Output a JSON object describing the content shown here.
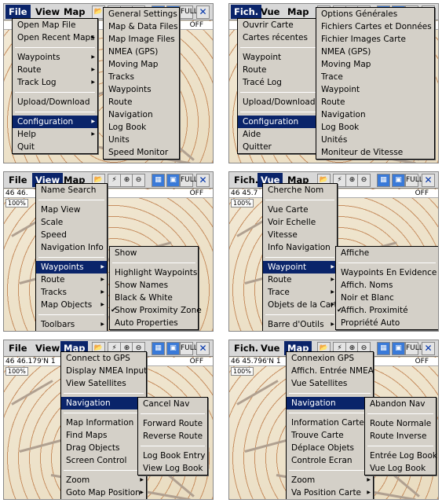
{
  "panels": [
    {
      "menus": [
        "File",
        "View",
        "Map"
      ],
      "coord": "",
      "off": "OFF",
      "zoom": "",
      "active": 0,
      "main": [
        {
          "t": "Open Map File"
        },
        {
          "t": "Open Recent Maps",
          "sub": 1
        },
        {
          "sep": 1
        },
        {
          "t": "Waypoints",
          "sub": 1
        },
        {
          "t": "Route",
          "sub": 1
        },
        {
          "t": "Track Log",
          "sub": 1
        },
        {
          "sep": 1
        },
        {
          "t": "Upload/Download"
        },
        {
          "sep": 1
        },
        {
          "t": "Configuration",
          "sub": 1,
          "sel": 1
        },
        {
          "t": "Help",
          "sub": 1
        },
        {
          "t": "Quit"
        }
      ],
      "submenu": [
        {
          "t": "General Settings"
        },
        {
          "t": "Map & Data Files"
        },
        {
          "t": "Map Image Files"
        },
        {
          "t": "NMEA (GPS)"
        },
        {
          "t": "Moving Map"
        },
        {
          "t": "Tracks"
        },
        {
          "t": "Waypoints"
        },
        {
          "t": "Route"
        },
        {
          "t": "Navigation"
        },
        {
          "t": "Log Book"
        },
        {
          "t": "Units"
        },
        {
          "t": "Speed Monitor"
        }
      ]
    },
    {
      "menus": [
        "Fich.",
        "Vue",
        "Map"
      ],
      "coord": "",
      "off": "OFF",
      "zoom": "",
      "active": 0,
      "main": [
        {
          "t": "Ouvrir Carte"
        },
        {
          "t": "Cartes récentes",
          "sub": 1
        },
        {
          "sep": 1
        },
        {
          "t": "Waypoint",
          "sub": 1
        },
        {
          "t": "Route",
          "sub": 1
        },
        {
          "t": "Tracé Log",
          "sub": 1
        },
        {
          "sep": 1
        },
        {
          "t": "Upload/Download"
        },
        {
          "sep": 1
        },
        {
          "t": "Configuration",
          "sub": 1,
          "sel": 1
        },
        {
          "t": "Aide",
          "sub": 1
        },
        {
          "t": "Quitter"
        }
      ],
      "submenu": [
        {
          "t": "Options Générales"
        },
        {
          "t": "Fichiers Cartes et Données"
        },
        {
          "t": "Fichier Images Carte"
        },
        {
          "t": "NMEA (GPS)"
        },
        {
          "t": "Moving Map"
        },
        {
          "t": "Trace"
        },
        {
          "t": "Waypoint"
        },
        {
          "t": "Route"
        },
        {
          "t": "Navigation"
        },
        {
          "t": "Log Book"
        },
        {
          "t": "Unités"
        },
        {
          "t": "Moniteur de Vitesse"
        }
      ]
    },
    {
      "menus": [
        "File",
        "View",
        "Map"
      ],
      "coord": "46 46.",
      "off": "OFF",
      "zoom": "100%",
      "active": 1,
      "main": [
        {
          "t": "Name Search"
        },
        {
          "sep": 1
        },
        {
          "t": "Map View"
        },
        {
          "t": "Scale"
        },
        {
          "t": "Speed"
        },
        {
          "t": "Navigation Info"
        },
        {
          "sep": 1
        },
        {
          "t": "Waypoints",
          "sub": 1,
          "sel": 1
        },
        {
          "t": "Route",
          "sub": 1
        },
        {
          "t": "Tracks",
          "sub": 1
        },
        {
          "t": "Map Objects",
          "sub": 1
        },
        {
          "sep": 1
        },
        {
          "t": "Toolbars",
          "sub": 1
        }
      ],
      "submenu": [
        {
          "t": "Show"
        },
        {
          "sep": 1
        },
        {
          "t": "Highlight Waypoints"
        },
        {
          "t": "Show Names"
        },
        {
          "t": "Black & White"
        },
        {
          "t": "Show Proximity Zone",
          "chk": 1
        },
        {
          "t": "Auto Properties"
        }
      ]
    },
    {
      "menus": [
        "Fich.",
        "Vue",
        "Map"
      ],
      "coord": "46 45.7",
      "off": "OFF",
      "zoom": "100%",
      "active": 1,
      "main": [
        {
          "t": "Cherche Nom"
        },
        {
          "sep": 1
        },
        {
          "t": "Vue Carte"
        },
        {
          "t": "Voir Echelle"
        },
        {
          "t": "Vitesse"
        },
        {
          "t": "Info Navigation"
        },
        {
          "sep": 1
        },
        {
          "t": "Waypoint",
          "sub": 1,
          "sel": 1
        },
        {
          "t": "Route",
          "sub": 1
        },
        {
          "t": "Trace",
          "sub": 1
        },
        {
          "t": "Objets de la Carte",
          "sub": 1
        },
        {
          "sep": 1
        },
        {
          "t": "Barre d'Outils",
          "sub": 1
        }
      ],
      "submenu": [
        {
          "t": "Affiche"
        },
        {
          "sep": 1
        },
        {
          "t": "Waypoints En Evidence"
        },
        {
          "t": "Affich. Noms"
        },
        {
          "t": "Noir et Blanc"
        },
        {
          "t": "Affich. Proximité",
          "chk": 1
        },
        {
          "t": "Propriété Auto"
        }
      ]
    },
    {
      "menus": [
        "File",
        "View",
        "Map"
      ],
      "coord": "46 46.179'N 1",
      "off": "OFF",
      "zoom": "100%",
      "active": 2,
      "main": [
        {
          "t": "Connect to GPS"
        },
        {
          "t": "Display NMEA Input"
        },
        {
          "t": "View Satellites"
        },
        {
          "sep": 1
        },
        {
          "t": "Navigation",
          "sub": 1,
          "sel": 1
        },
        {
          "sep": 1
        },
        {
          "t": "Map Information"
        },
        {
          "t": "Find Maps"
        },
        {
          "t": "Drag Objects"
        },
        {
          "t": "Screen Control"
        },
        {
          "sep": 1
        },
        {
          "t": "Zoom",
          "sub": 1
        },
        {
          "t": "Goto Map Position",
          "sub": 1
        }
      ],
      "submenu": [
        {
          "t": "Cancel Nav"
        },
        {
          "sep": 1
        },
        {
          "t": "Forward Route"
        },
        {
          "t": "Reverse Route"
        },
        {
          "sep": 1
        },
        {
          "t": "Log Book Entry"
        },
        {
          "t": "View Log Book"
        }
      ]
    },
    {
      "menus": [
        "Fich.",
        "Vue",
        "Map"
      ],
      "coord": "46 45.796'N 1",
      "off": "OFF",
      "zoom": "100%",
      "active": 2,
      "main": [
        {
          "t": "Connexion GPS"
        },
        {
          "t": "Affich. Entrée NMEA"
        },
        {
          "t": "Vue Satellites"
        },
        {
          "sep": 1
        },
        {
          "t": "Navigation",
          "sub": 1,
          "sel": 1
        },
        {
          "sep": 1
        },
        {
          "t": "Information Carte"
        },
        {
          "t": "Trouve Carte"
        },
        {
          "t": "Déplace Objets"
        },
        {
          "t": "Controle Ecran"
        },
        {
          "sep": 1
        },
        {
          "t": "Zoom",
          "sub": 1
        },
        {
          "t": "Va Position Carte",
          "sub": 1
        }
      ],
      "submenu": [
        {
          "t": "Abandon Nav"
        },
        {
          "sep": 1
        },
        {
          "t": "Route Normale"
        },
        {
          "t": "Route Inverse"
        },
        {
          "sep": 1
        },
        {
          "t": "Entrée Log Book"
        },
        {
          "t": "Vue Log Book"
        }
      ]
    }
  ],
  "toolbar_icons": [
    "folder-icon",
    "gps-icon",
    "zoom-in-icon",
    "zoom-out-icon",
    "map-small-icon",
    "map-image-icon",
    "full-screen-icon",
    "close-icon"
  ],
  "toolbar_labels": {
    "full": "FULL",
    "close": "✕",
    "zoom_in": "⊕",
    "zoom_out": "⊖",
    "folder": "📂",
    "gps": "⚡",
    "map1": "▦",
    "map2": "▣"
  }
}
